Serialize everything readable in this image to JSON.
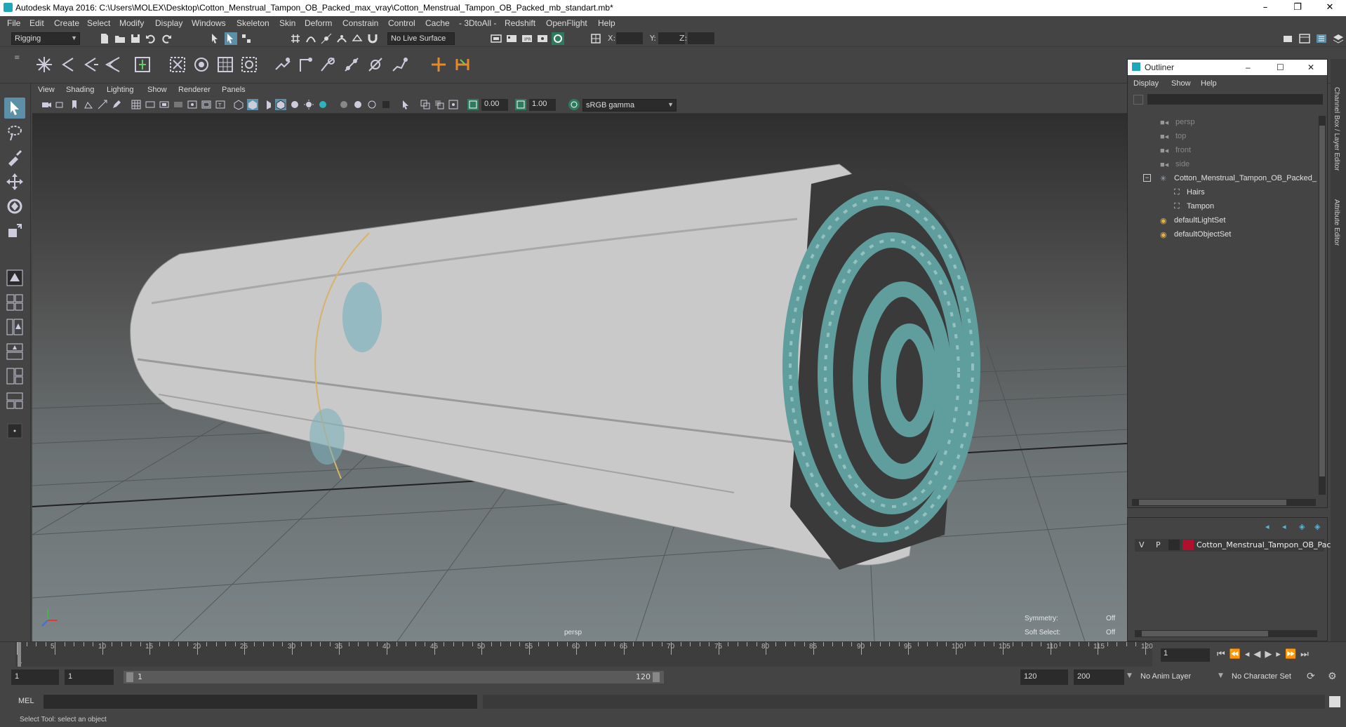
{
  "window": {
    "title": "Autodesk Maya 2016: C:\\Users\\MOLEX\\Desktop\\Cotton_Menstrual_Tampon_OB_Packed_max_vray\\Cotton_Menstrual_Tampon_OB_Packed_mb_standart.mb*",
    "minimize": "–",
    "restore": "❐",
    "close": "✕"
  },
  "menubar": [
    "File",
    "Edit",
    "Create",
    "Select",
    "Modify",
    "Display",
    "Windows",
    "Skeleton",
    "Skin",
    "Deform",
    "Constrain",
    "Control",
    "Cache",
    "- 3DtoAll -",
    "Redshift",
    "OpenFlight",
    "Help"
  ],
  "status": {
    "menuset": "Rigging",
    "live_surface": "No Live Surface",
    "x_label": "X:",
    "y_label": "Y:",
    "z_label": "Z:"
  },
  "panel": {
    "menus": [
      "View",
      "Shading",
      "Lighting",
      "Show",
      "Renderer",
      "Panels"
    ],
    "exposure": "0.00",
    "gamma": "1.00",
    "colorspace": "sRGB gamma"
  },
  "viewport": {
    "camera": "persp",
    "symmetry_label": "Symmetry:",
    "symmetry_value": "Off",
    "soft_select_label": "Soft Select:",
    "soft_select_value": "Off",
    "colors": {
      "wrapper": "#c9c9c9",
      "coil": "#5f9e9c",
      "print": "#7fb3bd"
    }
  },
  "outliner": {
    "title": "Outliner",
    "menus": [
      "Display",
      "Show",
      "Help"
    ],
    "items": [
      {
        "label": "persp",
        "icon": "camera-icon",
        "dim": true
      },
      {
        "label": "top",
        "icon": "camera-icon",
        "dim": true
      },
      {
        "label": "front",
        "icon": "camera-icon",
        "dim": true
      },
      {
        "label": "side",
        "icon": "camera-icon",
        "dim": true
      },
      {
        "label": "Cotton_Menstrual_Tampon_OB_Packed_",
        "icon": "group-icon",
        "dim": false
      },
      {
        "label": "Hairs",
        "icon": "mesh-icon",
        "dim": false
      },
      {
        "label": "Tampon",
        "icon": "mesh-icon",
        "dim": false
      },
      {
        "label": "defaultLightSet",
        "icon": "set-icon",
        "dim": false
      },
      {
        "label": "defaultObjectSet",
        "icon": "set-icon",
        "dim": false
      }
    ]
  },
  "layer": {
    "v": "V",
    "p": "P",
    "name": "Cotton_Menstrual_Tampon_OB_Pac",
    "color": "#b0102c"
  },
  "side_tabs": [
    "Channel Box / Layer Editor",
    "Attribute Editor"
  ],
  "timeline": {
    "ticks": [
      "5",
      "10",
      "15",
      "20",
      "25",
      "30",
      "35",
      "40",
      "45",
      "50",
      "55",
      "60",
      "65",
      "70",
      "75",
      "80",
      "85",
      "90",
      "95",
      "100",
      "105",
      "110",
      "115",
      "120"
    ],
    "start_label": "1",
    "current_frame": "1"
  },
  "range": {
    "start": "1",
    "playback_start": "1",
    "slider_start": "1",
    "slider_end": "120",
    "playback_end": "120",
    "end": "200",
    "anim_layer": "No Anim Layer",
    "character_set": "No Character Set"
  },
  "mel": {
    "label": "MEL"
  },
  "help": {
    "text": "Select Tool: select an object"
  }
}
